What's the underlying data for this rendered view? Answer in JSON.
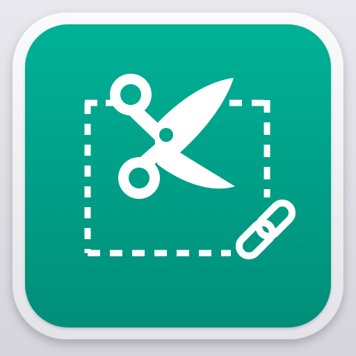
{
  "icon": {
    "semantic": "cut-paste-link-app-icon",
    "glyphs": [
      "scissors-icon",
      "dashed-selection-icon",
      "link-chain-icon"
    ]
  },
  "colors": {
    "page_background": "#e0dfe5",
    "outer_frame": "#f2f2f4",
    "tile_top": "#00b196",
    "tile_bottom": "#008e79",
    "glyph": "#ffffff"
  }
}
